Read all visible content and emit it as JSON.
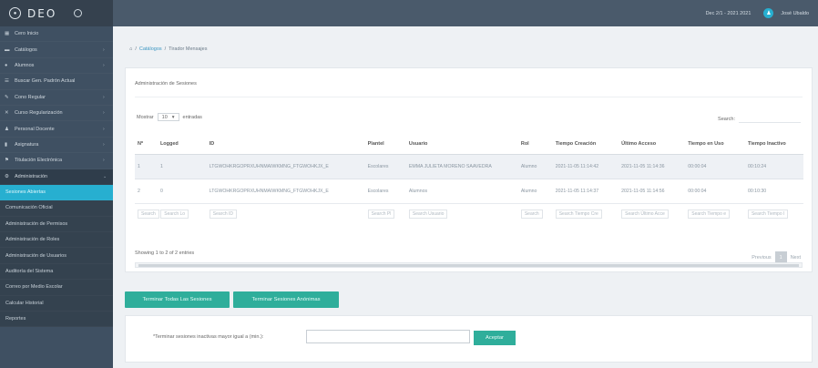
{
  "app": {
    "title": "DEO"
  },
  "topbar": {
    "date": "Dec 2/1 - 2021 2021",
    "user": "José Ubaldo"
  },
  "sidebar": {
    "items": [
      {
        "label": "Cero Inicio",
        "icon": "grid-icon",
        "chev": ""
      },
      {
        "label": "Catálogos",
        "icon": "folder-icon",
        "chev": "›"
      },
      {
        "label": "Alumnos",
        "icon": "user-icon",
        "chev": "›"
      },
      {
        "label": "Buscar Gen. Padrón Actual",
        "icon": "list-icon",
        "chev": ""
      },
      {
        "label": "Cono Regular",
        "icon": "edit-icon",
        "chev": "›"
      },
      {
        "label": "Curso Regularización",
        "icon": "book-icon",
        "chev": "›"
      },
      {
        "label": "Personal Docente",
        "icon": "person-icon",
        "chev": "›"
      },
      {
        "label": "Asignatura",
        "icon": "books-icon",
        "chev": "›"
      },
      {
        "label": "Titulación Electrónica",
        "icon": "diploma-icon",
        "chev": "›"
      },
      {
        "label": "Administración",
        "icon": "admin-icon",
        "chev": "⌄"
      }
    ],
    "sub_items": [
      "Sesiones Abiertas",
      "Comunicación Oficial",
      "Administración de Permisos",
      "Administración de Roles",
      "Administración de Usuarios",
      "Auditoría del Sistema",
      "Correo por Medio Escolar",
      "Calcular Historial",
      "Reportes"
    ]
  },
  "breadcrumb": {
    "home": "⌂",
    "sep1": "/",
    "link": "Catálogos",
    "sep2": "/",
    "current": "Tirador Mensajes"
  },
  "panel": {
    "title": "Administración de Sesiones",
    "show_label": "Mostrar",
    "show_value": "10",
    "show_suffix": "entradas",
    "search_label": "Search:"
  },
  "table": {
    "headers": [
      "Nº",
      "Logged",
      "ID",
      "Plantel",
      "Usuario",
      "Rol",
      "Tiempo Creación",
      "Último Acceso",
      "Tiempo en Uso",
      "Tiempo Inactivo"
    ],
    "rows": [
      [
        "1",
        "1",
        "LTGWOHKRGOPRXUHNMAIWKMNG_FTGWOHKJX_E",
        "Escolares",
        "EMMA JULIETA MORENO SAAVEDRA",
        "Alumno",
        "2021-11-05 11:14:42",
        "2021-11-05 11:14:36",
        "00:00:04",
        "00:10:24"
      ],
      [
        "2",
        "0",
        "LTGWOHKRGOPRXUHNMAIWKMNG_FTGWOHKJX_E",
        "Escolares",
        "Alumnos",
        "Alumno",
        "2021-11-05 11:14:37",
        "2021-11-05 11:14:56",
        "00:00:04",
        "00:10:30"
      ]
    ],
    "filters": [
      "Search",
      "Search Lo",
      "Search ID",
      "Search Pl",
      "Search Usuario",
      "Search",
      "Search Tiempo Cre",
      "Search Último Acce",
      "Search Tiempo e",
      "Search Tiempo I"
    ]
  },
  "info": {
    "showing": "Showing 1 to 2 of 2 entries",
    "prev": "Previous",
    "page": "1",
    "next": "Next"
  },
  "actions": {
    "terminate_all": "Terminar Todas Las Sesiones",
    "terminate_inactive": "Terminar Sesiones Anónimas"
  },
  "inactive": {
    "label": "*Terminar sesiones inactivas mayor igual a (min.):",
    "input_value": "",
    "accept": "Aceptar"
  }
}
